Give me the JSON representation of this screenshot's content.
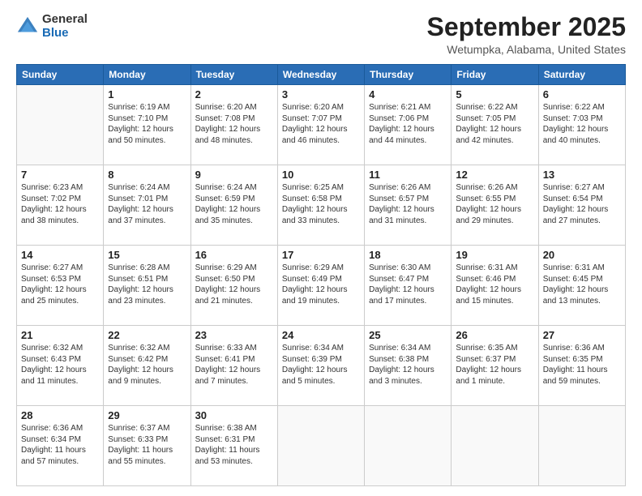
{
  "header": {
    "logo": {
      "general": "General",
      "blue": "Blue"
    },
    "title": "September 2025",
    "location": "Wetumpka, Alabama, United States"
  },
  "days_of_week": [
    "Sunday",
    "Monday",
    "Tuesday",
    "Wednesday",
    "Thursday",
    "Friday",
    "Saturday"
  ],
  "weeks": [
    [
      {
        "day": "",
        "sunrise": "",
        "sunset": "",
        "daylight": ""
      },
      {
        "day": "1",
        "sunrise": "Sunrise: 6:19 AM",
        "sunset": "Sunset: 7:10 PM",
        "daylight": "Daylight: 12 hours and 50 minutes."
      },
      {
        "day": "2",
        "sunrise": "Sunrise: 6:20 AM",
        "sunset": "Sunset: 7:08 PM",
        "daylight": "Daylight: 12 hours and 48 minutes."
      },
      {
        "day": "3",
        "sunrise": "Sunrise: 6:20 AM",
        "sunset": "Sunset: 7:07 PM",
        "daylight": "Daylight: 12 hours and 46 minutes."
      },
      {
        "day": "4",
        "sunrise": "Sunrise: 6:21 AM",
        "sunset": "Sunset: 7:06 PM",
        "daylight": "Daylight: 12 hours and 44 minutes."
      },
      {
        "day": "5",
        "sunrise": "Sunrise: 6:22 AM",
        "sunset": "Sunset: 7:05 PM",
        "daylight": "Daylight: 12 hours and 42 minutes."
      },
      {
        "day": "6",
        "sunrise": "Sunrise: 6:22 AM",
        "sunset": "Sunset: 7:03 PM",
        "daylight": "Daylight: 12 hours and 40 minutes."
      }
    ],
    [
      {
        "day": "7",
        "sunrise": "Sunrise: 6:23 AM",
        "sunset": "Sunset: 7:02 PM",
        "daylight": "Daylight: 12 hours and 38 minutes."
      },
      {
        "day": "8",
        "sunrise": "Sunrise: 6:24 AM",
        "sunset": "Sunset: 7:01 PM",
        "daylight": "Daylight: 12 hours and 37 minutes."
      },
      {
        "day": "9",
        "sunrise": "Sunrise: 6:24 AM",
        "sunset": "Sunset: 6:59 PM",
        "daylight": "Daylight: 12 hours and 35 minutes."
      },
      {
        "day": "10",
        "sunrise": "Sunrise: 6:25 AM",
        "sunset": "Sunset: 6:58 PM",
        "daylight": "Daylight: 12 hours and 33 minutes."
      },
      {
        "day": "11",
        "sunrise": "Sunrise: 6:26 AM",
        "sunset": "Sunset: 6:57 PM",
        "daylight": "Daylight: 12 hours and 31 minutes."
      },
      {
        "day": "12",
        "sunrise": "Sunrise: 6:26 AM",
        "sunset": "Sunset: 6:55 PM",
        "daylight": "Daylight: 12 hours and 29 minutes."
      },
      {
        "day": "13",
        "sunrise": "Sunrise: 6:27 AM",
        "sunset": "Sunset: 6:54 PM",
        "daylight": "Daylight: 12 hours and 27 minutes."
      }
    ],
    [
      {
        "day": "14",
        "sunrise": "Sunrise: 6:27 AM",
        "sunset": "Sunset: 6:53 PM",
        "daylight": "Daylight: 12 hours and 25 minutes."
      },
      {
        "day": "15",
        "sunrise": "Sunrise: 6:28 AM",
        "sunset": "Sunset: 6:51 PM",
        "daylight": "Daylight: 12 hours and 23 minutes."
      },
      {
        "day": "16",
        "sunrise": "Sunrise: 6:29 AM",
        "sunset": "Sunset: 6:50 PM",
        "daylight": "Daylight: 12 hours and 21 minutes."
      },
      {
        "day": "17",
        "sunrise": "Sunrise: 6:29 AM",
        "sunset": "Sunset: 6:49 PM",
        "daylight": "Daylight: 12 hours and 19 minutes."
      },
      {
        "day": "18",
        "sunrise": "Sunrise: 6:30 AM",
        "sunset": "Sunset: 6:47 PM",
        "daylight": "Daylight: 12 hours and 17 minutes."
      },
      {
        "day": "19",
        "sunrise": "Sunrise: 6:31 AM",
        "sunset": "Sunset: 6:46 PM",
        "daylight": "Daylight: 12 hours and 15 minutes."
      },
      {
        "day": "20",
        "sunrise": "Sunrise: 6:31 AM",
        "sunset": "Sunset: 6:45 PM",
        "daylight": "Daylight: 12 hours and 13 minutes."
      }
    ],
    [
      {
        "day": "21",
        "sunrise": "Sunrise: 6:32 AM",
        "sunset": "Sunset: 6:43 PM",
        "daylight": "Daylight: 12 hours and 11 minutes."
      },
      {
        "day": "22",
        "sunrise": "Sunrise: 6:32 AM",
        "sunset": "Sunset: 6:42 PM",
        "daylight": "Daylight: 12 hours and 9 minutes."
      },
      {
        "day": "23",
        "sunrise": "Sunrise: 6:33 AM",
        "sunset": "Sunset: 6:41 PM",
        "daylight": "Daylight: 12 hours and 7 minutes."
      },
      {
        "day": "24",
        "sunrise": "Sunrise: 6:34 AM",
        "sunset": "Sunset: 6:39 PM",
        "daylight": "Daylight: 12 hours and 5 minutes."
      },
      {
        "day": "25",
        "sunrise": "Sunrise: 6:34 AM",
        "sunset": "Sunset: 6:38 PM",
        "daylight": "Daylight: 12 hours and 3 minutes."
      },
      {
        "day": "26",
        "sunrise": "Sunrise: 6:35 AM",
        "sunset": "Sunset: 6:37 PM",
        "daylight": "Daylight: 12 hours and 1 minute."
      },
      {
        "day": "27",
        "sunrise": "Sunrise: 6:36 AM",
        "sunset": "Sunset: 6:35 PM",
        "daylight": "Daylight: 11 hours and 59 minutes."
      }
    ],
    [
      {
        "day": "28",
        "sunrise": "Sunrise: 6:36 AM",
        "sunset": "Sunset: 6:34 PM",
        "daylight": "Daylight: 11 hours and 57 minutes."
      },
      {
        "day": "29",
        "sunrise": "Sunrise: 6:37 AM",
        "sunset": "Sunset: 6:33 PM",
        "daylight": "Daylight: 11 hours and 55 minutes."
      },
      {
        "day": "30",
        "sunrise": "Sunrise: 6:38 AM",
        "sunset": "Sunset: 6:31 PM",
        "daylight": "Daylight: 11 hours and 53 minutes."
      },
      {
        "day": "",
        "sunrise": "",
        "sunset": "",
        "daylight": ""
      },
      {
        "day": "",
        "sunrise": "",
        "sunset": "",
        "daylight": ""
      },
      {
        "day": "",
        "sunrise": "",
        "sunset": "",
        "daylight": ""
      },
      {
        "day": "",
        "sunrise": "",
        "sunset": "",
        "daylight": ""
      }
    ]
  ]
}
